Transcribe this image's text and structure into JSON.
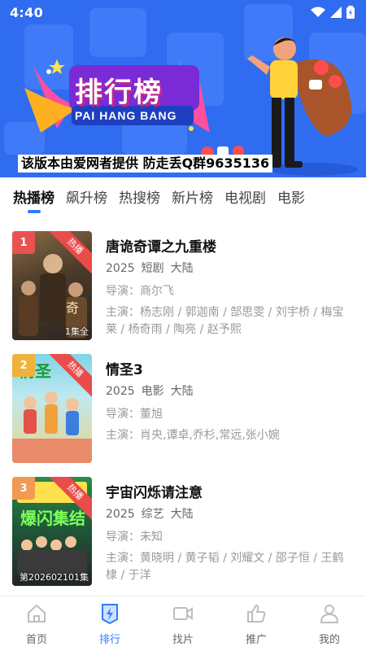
{
  "status_bar": {
    "time": "4:40"
  },
  "banner": {
    "logo_text": "排行榜",
    "logo_sub": "PAI HANG BANG",
    "notice": "该版本由爱网者提供 防走丢Q群9635136"
  },
  "tabs": [
    {
      "label": "热播榜",
      "active": true
    },
    {
      "label": "飙升榜"
    },
    {
      "label": "热搜榜"
    },
    {
      "label": "新片榜"
    },
    {
      "label": "电视剧"
    },
    {
      "label": "电影"
    }
  ],
  "items": [
    {
      "rank": "1",
      "badge": "热播",
      "episodes": "1集全",
      "title": "唐诡奇谭之九重楼",
      "year": "2025",
      "genre": "短剧",
      "region": "大陆",
      "director": "导演：商尔飞",
      "cast": "主演：杨志刚 / 郭迦南 / 郜思雯 / 刘宇桥 / 梅宝莱 / 杨奇雨 / 陶亮 / 赵予熙",
      "rank_color": "#e9534f"
    },
    {
      "rank": "2",
      "badge": "热播",
      "episodes": "",
      "title": "情圣3",
      "year": "2025",
      "genre": "电影",
      "region": "大陆",
      "director": "导演：董旭",
      "cast": "主演：肖央,谭卓,乔杉,常远,张小婉",
      "rank_color": "#f0b23a"
    },
    {
      "rank": "3",
      "badge": "热播",
      "episodes": "第202602101集",
      "title": "宇宙闪烁请注意",
      "year": "2025",
      "genre": "综艺",
      "region": "大陆",
      "director": "导演：未知",
      "cast": "主演：黄晓明 / 黄子韬 / 刘耀文 / 邵子恒 / 王鹤棣 / 于洋",
      "rank_color": "#f09a53"
    }
  ],
  "bottom_nav": [
    {
      "label": "首页",
      "icon": "home-icon"
    },
    {
      "label": "排行",
      "icon": "ranking-icon",
      "active": true
    },
    {
      "label": "找片",
      "icon": "video-camera-icon"
    },
    {
      "label": "推广",
      "icon": "thumbs-up-icon"
    },
    {
      "label": "我的",
      "icon": "user-icon"
    }
  ],
  "colors": {
    "accent": "#2f7bff",
    "banner_bg": "#2f6cf0",
    "hot": "#ea4b4b"
  }
}
